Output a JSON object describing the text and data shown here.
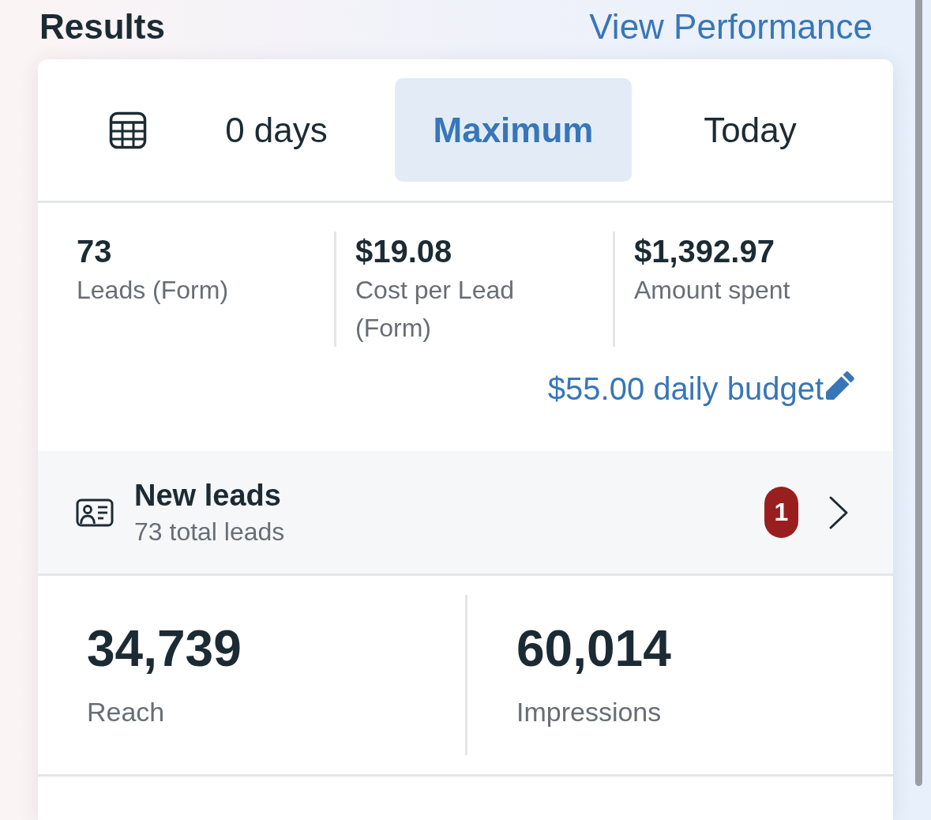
{
  "header": {
    "title": "Results",
    "link": "View Performance"
  },
  "date_tabs": [
    {
      "label": "0 days",
      "selected": false
    },
    {
      "label": "Maximum",
      "selected": true
    },
    {
      "label": "Today",
      "selected": false
    }
  ],
  "metrics": [
    {
      "value": "73",
      "label": "Leads (Form)"
    },
    {
      "value": "$19.08",
      "label": "Cost per Lead (Form)"
    },
    {
      "value": "$1,392.97",
      "label": "Amount spent"
    }
  ],
  "budget_link": "$55.00 daily budget",
  "new_leads": {
    "title": "New leads",
    "subtitle": "73 total leads",
    "badge": "1"
  },
  "stats": [
    {
      "value": "34,739",
      "label": "Reach"
    },
    {
      "value": "60,014",
      "label": "Impressions"
    }
  ]
}
